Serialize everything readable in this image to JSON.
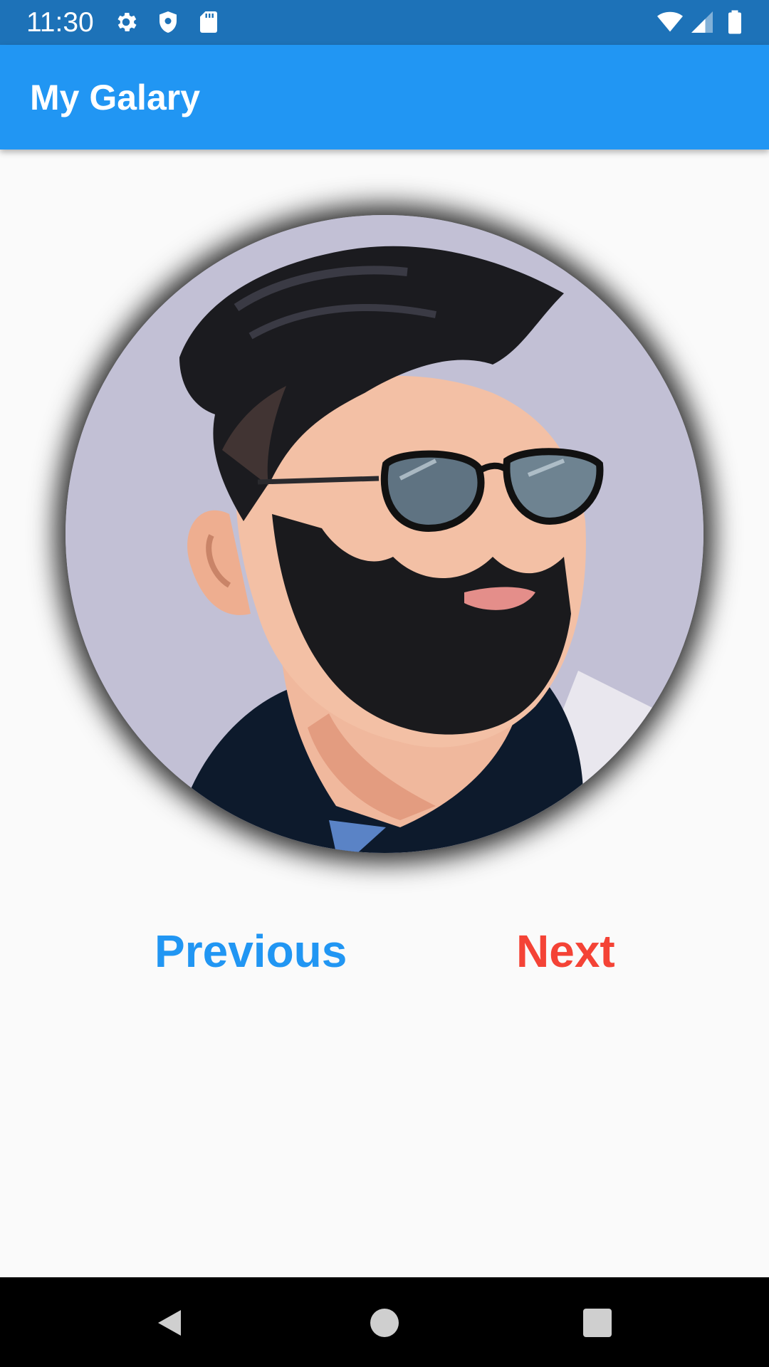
{
  "status_bar": {
    "time": "11:30",
    "background": "#1d72b8",
    "icons": [
      "settings-icon",
      "shield-icon",
      "sd-card-icon",
      "wifi-icon",
      "signal-icon",
      "battery-icon"
    ]
  },
  "app_bar": {
    "title": "My Galary",
    "background": "#2196f3"
  },
  "gallery": {
    "image": "cartoon-portrait-bearded-man-sunglasses"
  },
  "buttons": {
    "previous_label": "Previous",
    "previous_color": "#2196f3",
    "next_label": "Next",
    "next_color": "#f44336"
  },
  "nav_bar": {
    "icons": [
      "back-icon",
      "home-icon",
      "recents-icon"
    ]
  }
}
